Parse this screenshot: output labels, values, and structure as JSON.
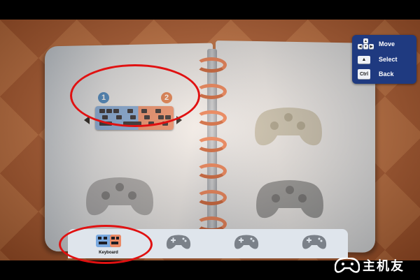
{
  "legend": {
    "move_label": "Move",
    "select_label": "Select",
    "back_label": "Back",
    "back_key": "Ctrl",
    "dpad_keys": [
      "▲",
      "◀",
      "▼",
      "▶"
    ],
    "select_key": "▲"
  },
  "input_selector": {
    "player1_badge": "1",
    "player2_badge": "2"
  },
  "tabs": [
    {
      "label": "Keyboard",
      "icon": "keyboard-icon"
    },
    {
      "label": "",
      "icon": "gamepad-icon"
    },
    {
      "label": "",
      "icon": "gamepad-icon"
    },
    {
      "label": "",
      "icon": "gamepad-icon"
    }
  ],
  "watermark": {
    "text": "主机友"
  },
  "colors": {
    "player1": "#3a82c4",
    "player2": "#e07846",
    "annotation": "#e01111",
    "legend_bg": "#1f3a80",
    "ring": "#ec7a4d"
  }
}
